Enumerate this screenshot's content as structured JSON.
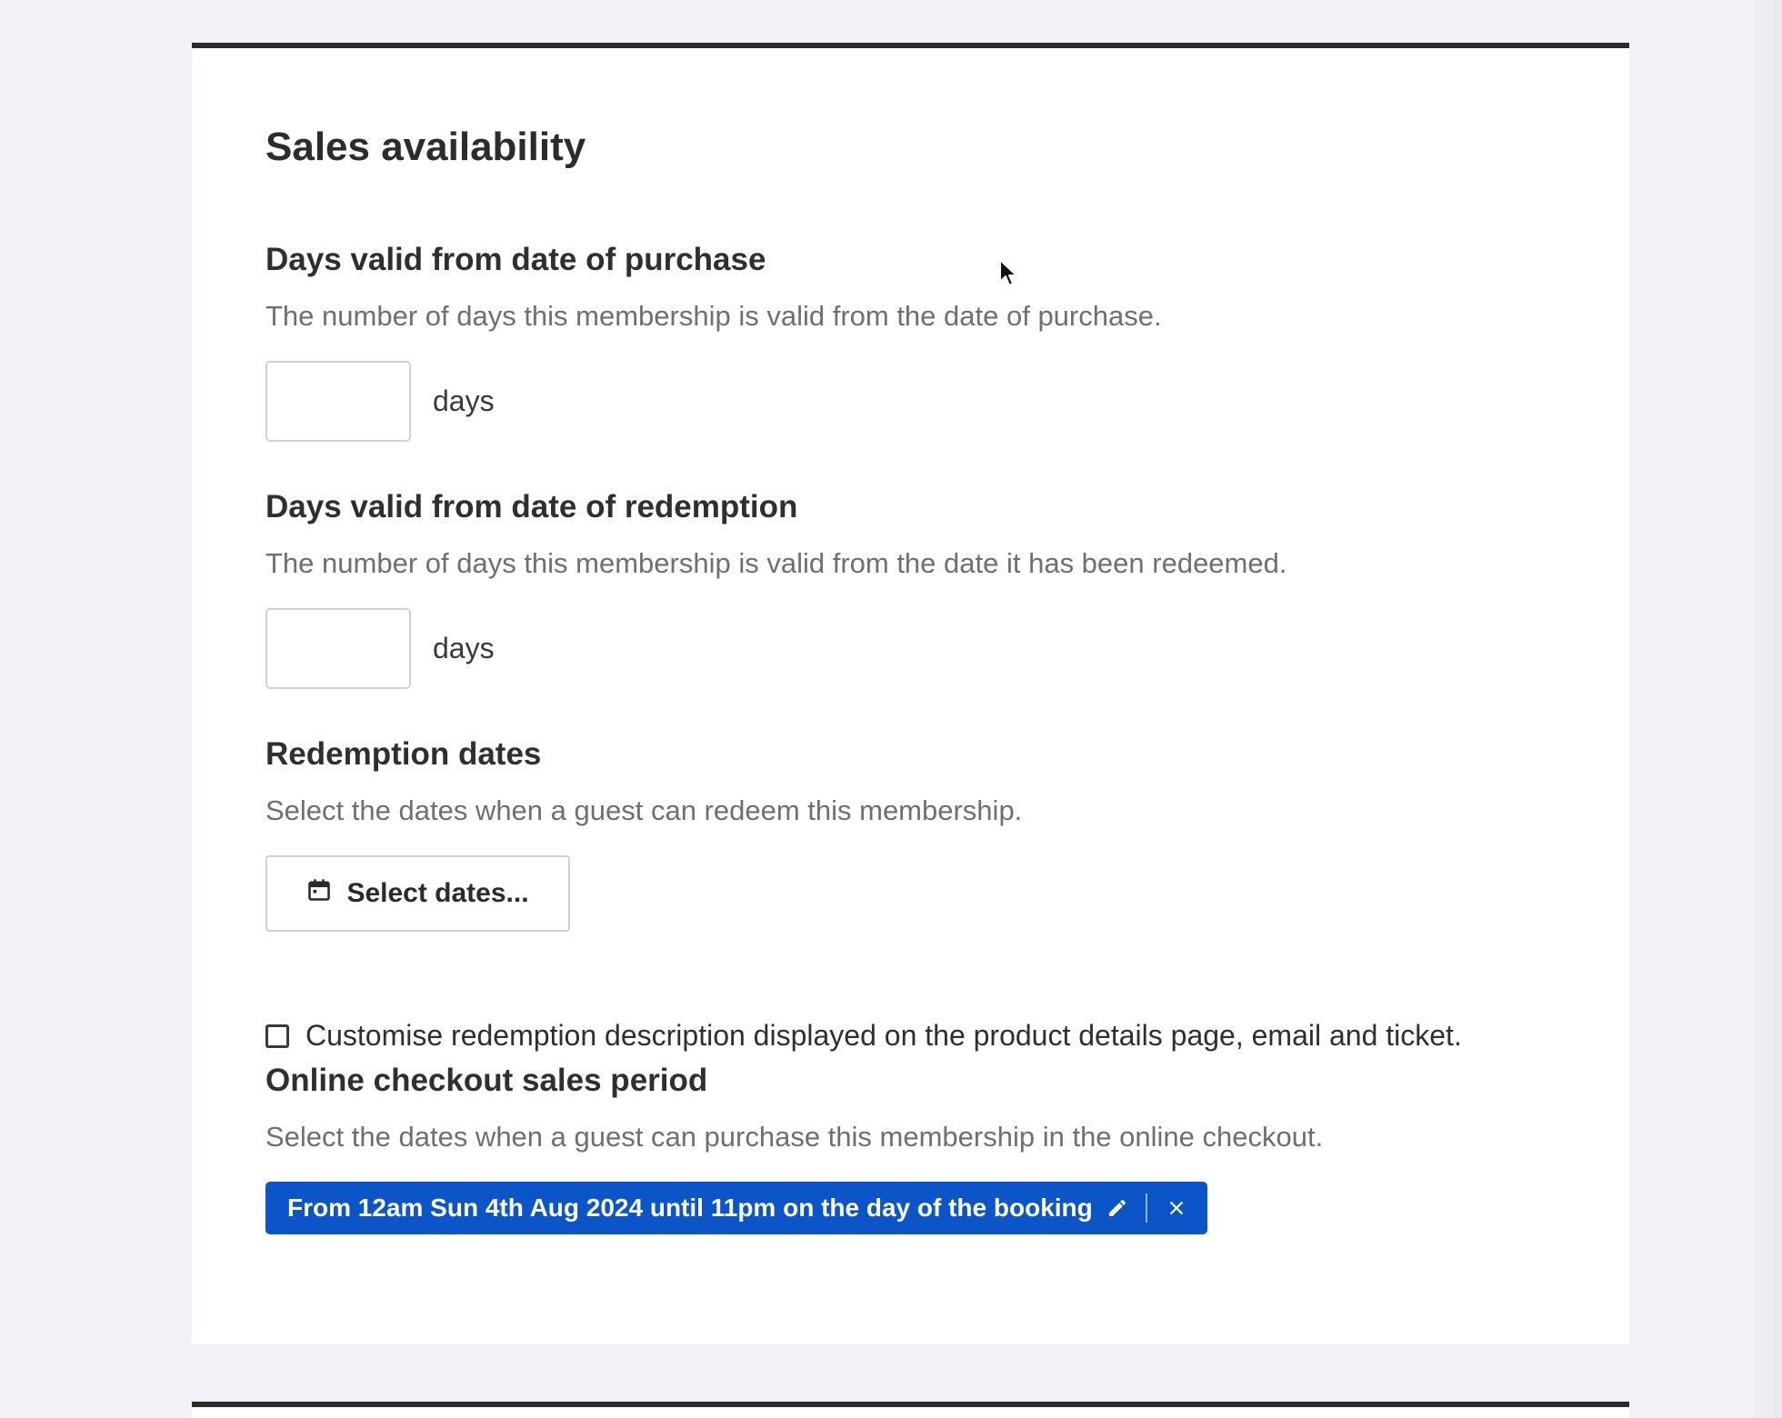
{
  "section": {
    "title": "Sales availability"
  },
  "purchase_validity": {
    "title": "Days valid from date of purchase",
    "description": "The number of days this membership is valid from the date of purchase.",
    "value": "",
    "unit": "days"
  },
  "redemption_validity": {
    "title": "Days valid from date of redemption",
    "description": "The number of days this membership is valid from the date it has been redeemed.",
    "value": "",
    "unit": "days"
  },
  "redemption_dates": {
    "title": "Redemption dates",
    "description": "Select the dates when a guest can redeem this membership.",
    "button_label": "Select dates...",
    "button_icon": "calendar-icon"
  },
  "customise_redemption": {
    "label": "Customise redemption description displayed on the product details page, email and ticket.",
    "checked": false
  },
  "online_checkout": {
    "title": "Online checkout sales period",
    "description": "Select the dates when a guest can purchase this membership in the online checkout.",
    "period_chip": "From 12am Sun 4th Aug 2024 until 11pm on the day of the booking",
    "edit_icon": "pencil-icon",
    "remove_icon": "close-icon"
  },
  "colors": {
    "page_background": "#f1f2f7",
    "card_background": "#ffffff",
    "card_top_border": "#2b2b2e",
    "chip_background": "#0b55c9",
    "muted_text": "#6d6f76"
  }
}
